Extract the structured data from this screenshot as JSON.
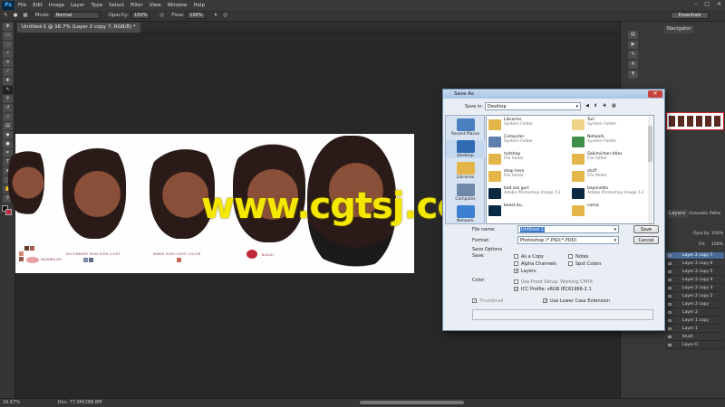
{
  "menubar": {
    "logo": "Ps",
    "items": [
      "File",
      "Edit",
      "Image",
      "Layer",
      "Type",
      "Select",
      "Filter",
      "View",
      "Window",
      "Help"
    ],
    "window_controls": [
      "–",
      "□",
      "✕"
    ]
  },
  "options": {
    "mode_label": "Mode:",
    "mode": "Normal",
    "opacity_label": "Opacity:",
    "opacity": "100%",
    "flow_label": "Flow:",
    "flow": "100%",
    "workspace": "Essentials"
  },
  "document": {
    "tab": "Untitled-1 @ 16.7% (Layer 2 copy 7, RGB/8) *",
    "zoom": "16.67%",
    "doc_size": "Doc: 77.0M/288.8M"
  },
  "canvas": {
    "labels": [
      "HAIRBRUSH",
      "SECONDARY SKIN HIGH LIGHT",
      "WARM HIGH LIGHT COLOR",
      "BLUSH"
    ]
  },
  "panels": {
    "navigator": "Navigator",
    "layers_tab": "Layers",
    "channels_tab": "Channels",
    "paths_tab": "Paths",
    "opacity_label": "Opacity:",
    "opacity": "100%",
    "fill_label": "Fill:",
    "fill": "100%",
    "layers": [
      "Layer 2 copy 7",
      "Layer 2 copy 6",
      "Layer 2 copy 5",
      "Layer 2 copy 4",
      "Layer 2 copy 3",
      "Layer 2 copy 2",
      "Layer 2 copy",
      "Layer 2",
      "Layer 1 copy",
      "Layer 1",
      "blush",
      "Layer 0"
    ]
  },
  "dialog": {
    "title": "Save As",
    "save_in_label": "Save in:",
    "save_in": "Desktop",
    "places": [
      "Recent Places",
      "Desktop",
      "Libraries",
      "Computer",
      "Network"
    ],
    "files": [
      {
        "name": "Libraries",
        "sub": "System Folder"
      },
      {
        "name": "Yuri",
        "sub": "System Folder"
      },
      {
        "name": "Computer",
        "sub": "System Folder"
      },
      {
        "name": "Network",
        "sub": "System Folder"
      },
      {
        "name": "hotshop",
        "sub": "File folder"
      },
      {
        "name": "Sakimichan titles",
        "sub": "File folder"
      },
      {
        "name": "shop here",
        "sub": "File folder"
      },
      {
        "name": "stuff",
        "sub": "File folder"
      },
      {
        "name": "bad ass gurl",
        "sub": "Adobe Photoshop Image 13"
      },
      {
        "name": "bayonetta",
        "sub": "Adobe Photoshop Image 13"
      },
      {
        "name": "beast bu...",
        "sub": ""
      },
      {
        "name": "comic",
        "sub": ""
      }
    ],
    "file_name_label": "File name:",
    "file_name": "Untitled-1",
    "format_label": "Format:",
    "format": "Photoshop (*.PSD;*.PDD)",
    "save_button": "Save",
    "cancel_button": "Cancel",
    "save_options_label": "Save Options",
    "save_label": "Save:",
    "as_copy": "As a Copy",
    "notes": "Notes",
    "alpha": "Alpha Channels",
    "spot": "Spot Colors",
    "layers": "Layers",
    "color_label": "Color:",
    "use_proof": "Use Proof Setup:  Working CMYK",
    "icc": "ICC Profile:  sRGB IEC61966-2.1",
    "thumbnail": "Thumbnail",
    "lowercase": "Use Lower Case Extension"
  },
  "watermark": "www.cgtsj.com",
  "colors": {
    "accent": "#4b6b99",
    "blush": "#c2263a"
  }
}
